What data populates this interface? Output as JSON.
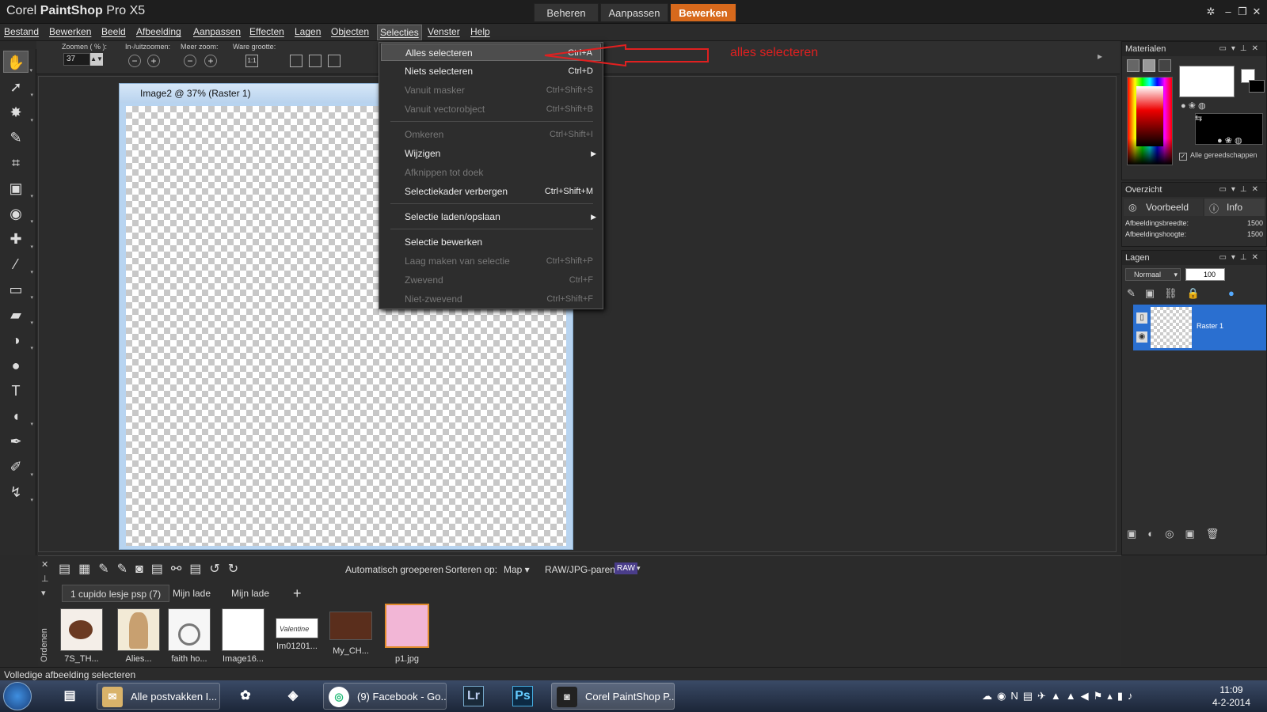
{
  "app": {
    "title_prefix": "Corel ",
    "title_bold": "PaintShop",
    "title_suffix": " Pro X5",
    "mode_tabs": [
      "Beheren",
      "Aanpassen",
      "Bewerken"
    ],
    "active_mode": "Bewerken"
  },
  "menubar": [
    "Bestand",
    "Bewerken",
    "Beeld",
    "Afbeelding",
    "Aanpassen",
    "Effecten",
    "Lagen",
    "Objecten",
    "Selecties",
    "Venster",
    "Help"
  ],
  "open_menu": "Selecties",
  "options": {
    "zoom_label": "Zoomen ( % ):",
    "zoom_value": "37",
    "zoom_inout_label": "In-/uitzoomen:",
    "more_zoom_label": "Meer zoom:",
    "actual_size_label": "Ware grootte:"
  },
  "image_window": {
    "title": "Image2 @  37% (Raster 1)"
  },
  "selecties_menu": [
    {
      "label": "Alles selecteren",
      "shortcut": "Ctrl+A",
      "disabled": false,
      "highlighted": true
    },
    {
      "label": "Niets selecteren",
      "shortcut": "Ctrl+D",
      "disabled": false
    },
    {
      "label": "Vanuit masker",
      "shortcut": "Ctrl+Shift+S",
      "disabled": true
    },
    {
      "label": "Vanuit vectorobject",
      "shortcut": "Ctrl+Shift+B",
      "disabled": true
    },
    {
      "label": "Omkeren",
      "shortcut": "Ctrl+Shift+I",
      "disabled": true
    },
    {
      "label": "Wijzigen",
      "shortcut": "",
      "disabled": false,
      "submenu": true
    },
    {
      "label": "Afknippen tot doek",
      "shortcut": "",
      "disabled": true
    },
    {
      "label": "Selectiekader verbergen",
      "shortcut": "Ctrl+Shift+M",
      "disabled": false
    },
    {
      "label": "Selectie laden/opslaan",
      "shortcut": "",
      "disabled": false,
      "submenu": true
    },
    {
      "label": "Selectie bewerken",
      "shortcut": "",
      "disabled": false
    },
    {
      "label": "Laag maken van selectie",
      "shortcut": "Ctrl+Shift+P",
      "disabled": true
    },
    {
      "label": "Zwevend",
      "shortcut": "Ctrl+F",
      "disabled": true
    },
    {
      "label": "Niet-zwevend",
      "shortcut": "Ctrl+Shift+F",
      "disabled": true
    }
  ],
  "annotation": "alles selecteren",
  "palettes": {
    "materials": {
      "title": "Materialen",
      "all_tools": "Alle gereedschappen"
    },
    "overview": {
      "title": "Overzicht",
      "tab_preview": "Voorbeeld",
      "tab_info": "Info",
      "rows": [
        {
          "label": "Afbeeldingsbreedte:",
          "value": "1500"
        },
        {
          "label": "Afbeeldingshoogte:",
          "value": "1500"
        }
      ]
    },
    "layers": {
      "title": "Lagen",
      "blend_mode": "Normaal",
      "opacity": "100",
      "layer_name": "Raster 1"
    }
  },
  "organizer": {
    "auto_group": "Automatisch groeperen",
    "sort_label": "Sorteren op:",
    "sort_value": "Map",
    "raw_label": "RAW/JPG-paren:",
    "raw_badge": "RAW",
    "side_label": "Ordenen",
    "tabs": [
      "1 cupido lesje psp (7)",
      "Mijn lade",
      "Mijn lade"
    ],
    "add_tab": "+",
    "thumbs": [
      "7S_TH...",
      "Alies...",
      "faith ho...",
      "Image16...",
      "Im01201...",
      "My_CH...",
      "p1.jpg"
    ]
  },
  "status": "Volledige afbeelding selecteren",
  "taskbar": {
    "buttons": [
      "Alle postvakken I...",
      "(9) Facebook - Go...",
      "Corel PaintShop P..."
    ],
    "icons": [
      "Lr",
      "Ps"
    ],
    "time": "11:09",
    "date": "4-2-2014"
  },
  "colors": {
    "accent": "#d7691c",
    "annotation": "#e02020",
    "layer_selected": "#2a6fd0"
  }
}
